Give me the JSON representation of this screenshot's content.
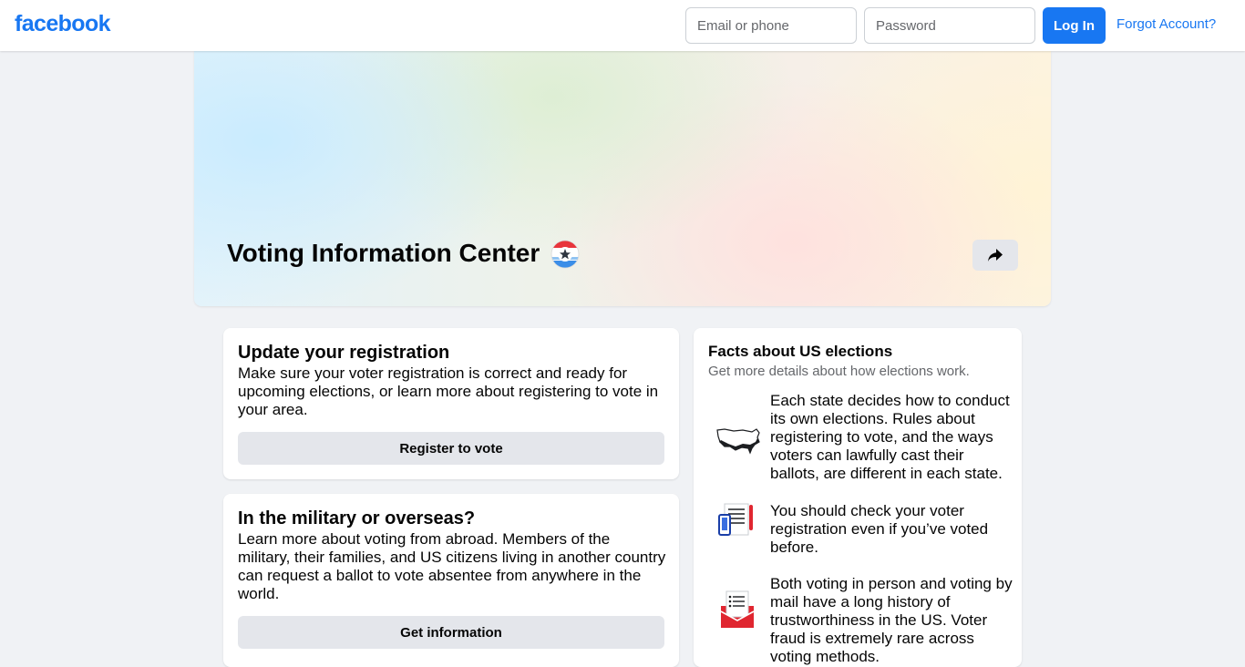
{
  "header": {
    "logo_text": "facebook",
    "email_placeholder": "Email or phone",
    "password_placeholder": "Password",
    "login_label": "Log In",
    "forgot_label": "Forgot Account?"
  },
  "hero": {
    "title": "Voting Information Center"
  },
  "registration_card": {
    "title": "Update your registration",
    "body": "Make sure your voter registration is correct and ready for upcoming elections, or learn more about registering to vote in your area.",
    "button_label": "Register to vote"
  },
  "military_card": {
    "title": "In the military or overseas?",
    "body": "Learn more about voting from abroad. Members of the military, their families, and US citizens living in another country can request a ballot to vote absentee from anywhere in the world.",
    "button_label": "Get information"
  },
  "facts_card": {
    "title": "Facts about US elections",
    "subtitle": "Get more details about how elections work.",
    "items": [
      {
        "icon": "us-map-icon",
        "text": "Each state decides how to conduct its own elections. Rules about registering to vote, and the ways voters can lawfully cast their ballots, are different in each state."
      },
      {
        "icon": "phone-checklist-icon",
        "text": "You should check your voter registration even if you’ve voted before."
      },
      {
        "icon": "mail-ballot-icon",
        "text": "Both voting in person and voting by mail have a long history of trustworthiness in the US. Voter fraud is extremely rare across voting methods."
      }
    ]
  },
  "colors": {
    "brand": "#1877f2",
    "page_background": "#f0f2f5",
    "button_gray": "#e4e6eb"
  }
}
